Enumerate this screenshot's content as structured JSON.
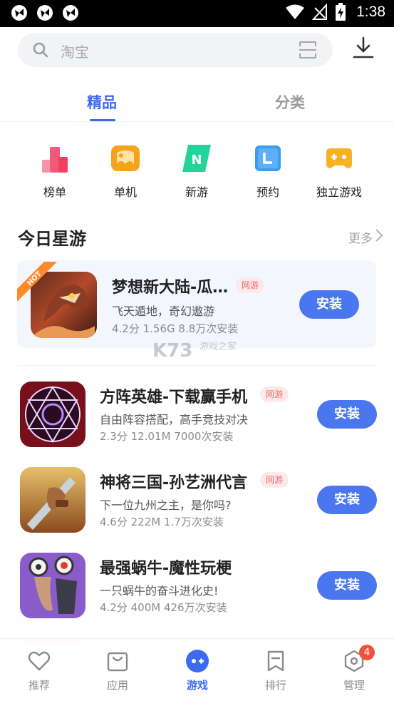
{
  "status_bar": {
    "time": "1:38",
    "left_icons": [
      "app-notification-icon",
      "app-notification-icon",
      "app-notification-icon"
    ],
    "right_icons": [
      "wifi-icon",
      "no-signal-icon",
      "battery-charging-icon"
    ]
  },
  "search": {
    "placeholder": "淘宝",
    "icons": [
      "search-icon",
      "scan-icon",
      "download-icon"
    ]
  },
  "tabs": [
    {
      "label": "精品",
      "active": true
    },
    {
      "label": "分类",
      "active": false
    }
  ],
  "quick_categories": [
    {
      "label": "榜单",
      "icon": "chart-bars-icon",
      "color": "#f25a7a"
    },
    {
      "label": "单机",
      "icon": "single-player-icon",
      "color": "#f7a21b"
    },
    {
      "label": "新游",
      "icon": "new-game-icon",
      "color": "#23d49a"
    },
    {
      "label": "预约",
      "icon": "reserve-icon",
      "color": "#3a9df2"
    },
    {
      "label": "独立游戏",
      "icon": "gamepad-icon",
      "color": "#f7b124"
    }
  ],
  "section": {
    "title": "今日星游",
    "more": "更多"
  },
  "featured": {
    "ribbon": "HOT",
    "name": "梦想新大陆-瓜…",
    "tag": "网游",
    "desc": "飞天遁地，奇幻遨游",
    "meta": "4.2分   1.56G  8.8万次安装",
    "install": "安装"
  },
  "watermark": {
    "brand": "K73",
    "sub": "游戏之家"
  },
  "apps": [
    {
      "name": "方阵英雄-下载赢手机",
      "tag": "网游",
      "desc": "自由阵容搭配，高手竞技对决",
      "meta": "2.3分   12.01M  7000次安装",
      "install": "安装"
    },
    {
      "name": "神将三国-孙艺洲代言",
      "tag": "网游",
      "desc": "下一位九州之主，是你吗?",
      "meta": "4.6分   222M  1.7万次安装",
      "install": "安装"
    },
    {
      "name": "最强蜗牛-魔性玩梗",
      "tag": "",
      "desc": "一只蜗牛的奋斗进化史!",
      "meta": "4.2分   400M  426万次安装",
      "install": "安装"
    }
  ],
  "bottom_nav": [
    {
      "label": "推荐",
      "icon": "heart-icon",
      "active": false
    },
    {
      "label": "应用",
      "icon": "shopping-bag-icon",
      "active": false
    },
    {
      "label": "游戏",
      "icon": "game-controller-icon",
      "active": true
    },
    {
      "label": "排行",
      "icon": "bookmark-icon",
      "active": false
    },
    {
      "label": "管理",
      "icon": "hexagon-settings-icon",
      "active": false,
      "badge": "4"
    }
  ],
  "colors": {
    "accent": "#3c6af3",
    "install_button": "#4a77ef",
    "tag_text": "#f06a6a",
    "badge": "#f2513d"
  }
}
